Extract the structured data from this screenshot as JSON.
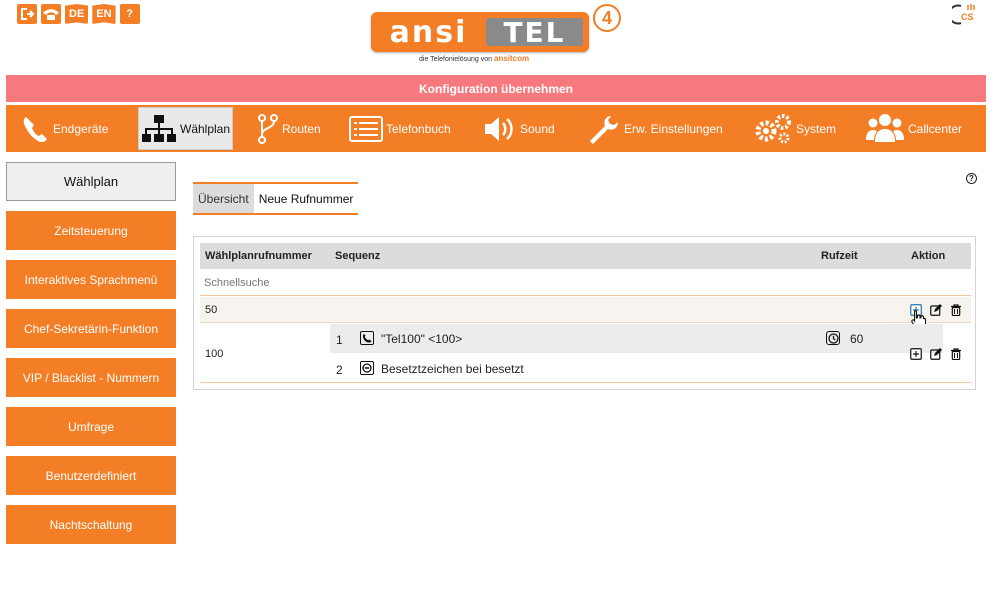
{
  "top_icons": [
    {
      "icon": "logout-icon"
    },
    {
      "icon": "phone-icon"
    },
    {
      "icon": "lang-de-icon",
      "label": "DE"
    },
    {
      "icon": "lang-en-icon",
      "label": "EN"
    },
    {
      "icon": "help-icon",
      "label": "?"
    }
  ],
  "brand": {
    "left": "ansi",
    "right": "TEL",
    "badge": "4",
    "tagline_prefix": "die Telefonielösung von",
    "tagline_brand": "ansit",
    "tagline_suffix": "com"
  },
  "corner_logo": {
    "icon": "cs-logo-icon",
    "label": "CS"
  },
  "config_bar": {
    "label": "Konfiguration übernehmen"
  },
  "nav": {
    "items": [
      {
        "label": "Endgeräte",
        "icon": "phone-handset-icon"
      },
      {
        "label": "Wählplan",
        "icon": "sitemap-icon",
        "active": true
      },
      {
        "label": "Routen",
        "icon": "route-icon"
      },
      {
        "label": "Telefonbuch",
        "icon": "list-icon"
      },
      {
        "label": "Sound",
        "icon": "speaker-icon"
      },
      {
        "label": "Erw. Einstellungen",
        "icon": "wrench-icon"
      },
      {
        "label": "System",
        "icon": "gears-icon"
      },
      {
        "label": "Callcenter",
        "icon": "users-icon"
      }
    ]
  },
  "sidebar": {
    "items": [
      {
        "label": "Wählplan",
        "active": true
      },
      {
        "label": "Zeitsteuerung"
      },
      {
        "label": "Interaktives Sprachmenü"
      },
      {
        "label": "Chef-Sekretärin-Funktion"
      },
      {
        "label": "VIP / Blacklist - Nummern"
      },
      {
        "label": "Umfrage"
      },
      {
        "label": "Benutzerdefiniert"
      },
      {
        "label": "Nachtschaltung"
      }
    ]
  },
  "help_icon": {
    "label": "?"
  },
  "tabs": [
    {
      "label": "Übersicht",
      "active": true
    },
    {
      "label": "Neue Rufnummer"
    }
  ],
  "table": {
    "headers": {
      "number": "Wählplanrufnummer",
      "sequence": "Sequenz",
      "ringtime": "Rufzeit",
      "action": "Aktion"
    },
    "search_placeholder": "Schnellsuche",
    "rows": [
      {
        "number": "50",
        "steps": []
      },
      {
        "number": "100",
        "steps": [
          {
            "index": "1",
            "icon": "phone-icon",
            "text": "\"Tel100\" <100>",
            "ringtime": "60"
          },
          {
            "index": "2",
            "icon": "busy-icon",
            "text": "Besetztzeichen bei besetzt"
          }
        ]
      }
    ]
  },
  "colors": {
    "accent": "#f47e26",
    "config_bar": "#f7797d",
    "header_bg": "#dcdcdc"
  }
}
